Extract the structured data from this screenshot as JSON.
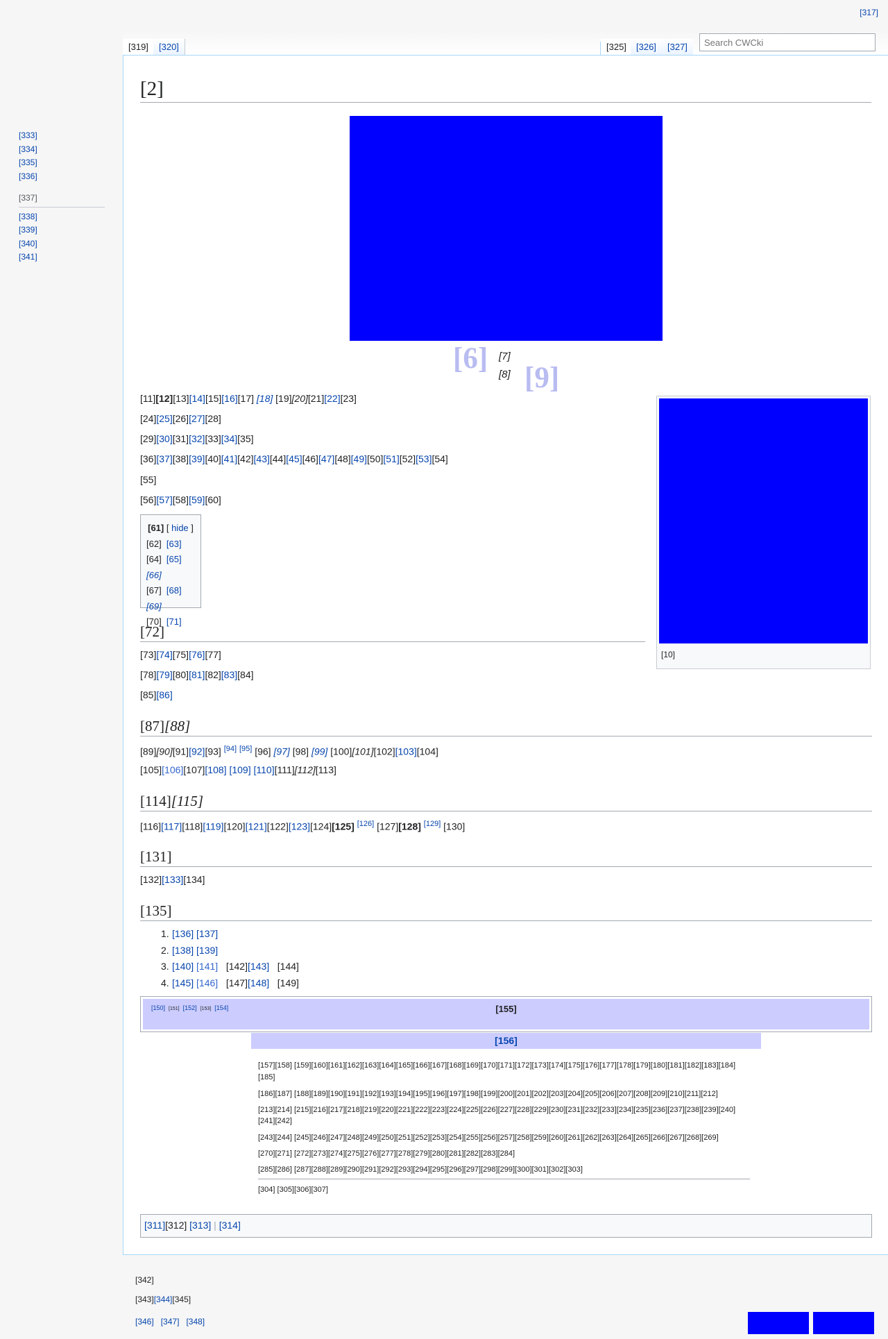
{
  "top_right_link": "[317]",
  "tabs_left": [
    "[319]",
    "[320]"
  ],
  "tabs_right": [
    "[325]",
    "[326]",
    "[327]"
  ],
  "search": {
    "placeholder": "Search CWCki"
  },
  "sidebar": {
    "group1": [
      "[333]",
      "[334]",
      "[335]",
      "[336]"
    ],
    "group2_title": "[337]",
    "group2": [
      "[338]",
      "[339]",
      "[340]",
      "[341]"
    ]
  },
  "page_title": "[2]",
  "caption": {
    "big1": "[6]",
    "line1": "[7]",
    "line2": "[8]",
    "big2": "[9]"
  },
  "thumb_caption": "[10]",
  "paragraphs": {
    "p1_a": "[11]",
    "p1_b": "[12]",
    "p1_c": "[13]",
    "p1_d": "[14]",
    "p1_e": "[15]",
    "p1_f": "[16]",
    "p1_g": "[17]",
    "p1_h": "[18]",
    "p1_i": "[19]",
    "p1_j": "[20]",
    "p1_k": "[21]",
    "p1_l": "[22]",
    "p1_m": "[23]",
    "p2_a": "[24]",
    "p2_b": "[25]",
    "p2_c": "[26]",
    "p2_d": "[27]",
    "p2_e": "[28]",
    "p3": [
      "[29]",
      "[30]",
      "[31]",
      "[32]",
      "[33]",
      "[34]",
      "[35]"
    ],
    "p4": [
      "[36]",
      "[37]",
      "[38]",
      "[39]",
      "[40]",
      "[41]",
      "[42]",
      "[43]",
      "[44]",
      "[45]",
      "[46]",
      "[47]",
      "[48]",
      "[49]",
      "[50]",
      "[51]",
      "[52]",
      "[53]",
      "[54]"
    ],
    "p5": "[55]",
    "p6": [
      "[56]",
      "[57]",
      "[58]",
      "[59]",
      "[60]"
    ]
  },
  "toc": {
    "title": "[61]",
    "hide": "hide",
    "rows": [
      {
        "num": "[62]",
        "a": "[63]",
        "b": ""
      },
      {
        "num": "[64]",
        "a": "[65]",
        "b": "[66]"
      },
      {
        "num": "[67]",
        "a": "[68]",
        "b": "[69]"
      },
      {
        "num": "[70]",
        "a": "[71]",
        "b": ""
      }
    ]
  },
  "sec1": {
    "heading": "[72]",
    "l1": [
      "[73]",
      "[74]",
      "[75]",
      "[76]",
      "[77]"
    ],
    "l2": [
      "[78]",
      "[79]",
      "[80]",
      "[81]",
      "[82]",
      "[83]",
      "[84]"
    ],
    "l3": [
      "[85]",
      "[86]"
    ]
  },
  "sec2": {
    "heading_a": "[87]",
    "heading_b": "[88]",
    "l1": [
      "[89]",
      "[90]",
      "[91]",
      "[92]",
      "[93]",
      "[94]",
      "[95]",
      "[96]",
      "[97]",
      "[98]",
      "[99]",
      "[100]",
      "[101]",
      "[102]",
      "[103]",
      "[104]"
    ],
    "l2": [
      "[105]",
      "[106]",
      "[107]",
      "[108]",
      "[109]",
      "[110]",
      "[111]",
      "[112]",
      "[113]"
    ]
  },
  "sec3": {
    "heading_a": "[114]",
    "heading_b": "[115]",
    "l1": [
      "[116]",
      "[117]",
      "[118]",
      "[119]",
      "[120]",
      "[121]",
      "[122]",
      "[123]",
      "[124]",
      "[125]",
      "[126]",
      "[127]",
      "[128]",
      "[129]",
      "[130]"
    ]
  },
  "sec4": {
    "heading": "[131]",
    "l1": [
      "[132]",
      "[133]",
      "[134]"
    ]
  },
  "sec5": {
    "heading": "[135]",
    "list": [
      {
        "n": "1.",
        "items": [
          "[136]",
          "[137]"
        ]
      },
      {
        "n": "2.",
        "items": [
          "[138]",
          "[139]"
        ]
      },
      {
        "n": "3.",
        "items": [
          "[140]",
          "[141]",
          "[142]",
          "[143]",
          "[144]"
        ]
      },
      {
        "n": "4.",
        "items": [
          "[145]",
          "[146]",
          "[147]",
          "[148]",
          "[149]"
        ]
      }
    ]
  },
  "navbox1": {
    "v": "[150]",
    "t": "[151]",
    "e": "[152]",
    "x": "[153]",
    "y": "[154]",
    "title": "[155]"
  },
  "navbox2": {
    "title": "[156]",
    "rows": [
      "[157][158] [159][160][161][162][163][164][165][166][167][168][169][170][171][172][173][174][175][176][177][178][179][180][181][182][183][184]",
      "[185]",
      "[186][187] [188][189][190][191][192][193][194][195][196][197][198][199][200][201][202][203][204][205][206][207][208][209][210][211][212]",
      "[213][214] [215][216][217][218][219][220][221][222][223][224][225][226][227][228][229][230][231][232][233][234][235][236][237][238][239][240]",
      "[241][242]",
      "[243][244] [245][246][247][248][249][250][251][252][253][254][255][256][257][258][259][260][261][262][263][264][265][266][267][268][269]",
      "[270][271] [272][273][274][275][276][277][278][279][280][281][282][283][284]",
      "[285][286] [287][288][289][290][291][292][293][294][295][296][297][298][299][300][301][302][303]",
      "[304] [305][306][307]"
    ]
  },
  "catlinks": {
    "a": "[311]",
    "b": "[312]",
    "c": "[313]",
    "d": "[314]"
  },
  "footer": {
    "l1": "[342]",
    "l2_a": "[343]",
    "l2_b": "[344]",
    "l2_c": "[345]",
    "l3": [
      "[346]",
      "[347]",
      "[348]"
    ]
  },
  "colors": {
    "link": "#0645ad",
    "navbox": "#ccccff",
    "image": "#0000ff",
    "caption_big": "#b9bcf1"
  }
}
